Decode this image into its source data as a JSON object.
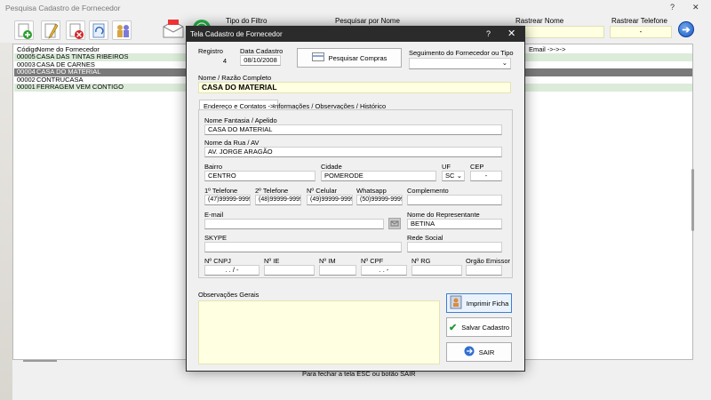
{
  "main_window": {
    "title": "Pesquisa Cadastro de Fornecedor",
    "help_glyph": "?",
    "close_glyph": "✕",
    "filter_type_label": "Tipo do Filtro",
    "search_name_label": "Pesquisar por Nome",
    "track_name_label": "Rastrear Nome",
    "track_phone_label": "Rastrear Telefone",
    "track_phone_value": "-",
    "email_header": "Email ->->->",
    "go_glyph": "➔",
    "footer_hint": "Para fechar a tela ESC ou botão SAIR"
  },
  "list": {
    "headers": {
      "code": "Código",
      "name": "Nome do Fornecedor"
    },
    "rows": [
      {
        "code": "00005",
        "name": "CASA DAS TINTAS RIBEIROS",
        "state": "green"
      },
      {
        "code": "00003",
        "name": "CASA DE CARNES",
        "state": "white"
      },
      {
        "code": "00004",
        "name": "CASA DO MATERIAL",
        "state": "selected"
      },
      {
        "code": "00002",
        "name": "CONTRUCASA",
        "state": "white"
      },
      {
        "code": "00001",
        "name": "FERRAGEM VEM CONTIGO",
        "state": "green"
      }
    ]
  },
  "dialog": {
    "title": "Tela Cadastro de Fornecedor",
    "help_glyph": "?",
    "close_glyph": "✕",
    "registro_label": "Registro",
    "registro_value": "4",
    "data_label": "Data Cadastro",
    "data_value": "08/10/2008",
    "pesquisar_compras": "Pesquisar Compras",
    "segmento_label": "Seguimento do Fornecedor ou Tipo",
    "segmento_value": "",
    "razao_label": "Nome / Razão Completo",
    "razao_value": "CASA DO MATERIAL",
    "tabs": [
      {
        "label": "Endereço e Contatos ->"
      },
      {
        "label": "Informações / Observações / Histórico"
      }
    ],
    "fantasia_label": "Nome Fantasia / Apelido",
    "fantasia_value": "CASA DO MATERIAL",
    "rua_label": "Nome da Rua / AV",
    "rua_value": "AV. JORGE ARAGÃO",
    "bairro_label": "Bairro",
    "bairro_value": "CENTRO",
    "cidade_label": "Cidade",
    "cidade_value": "POMERODE",
    "uf_label": "UF",
    "uf_value": "SC",
    "cep_label": "CEP",
    "cep_value": "-",
    "tel1_label": "1º Telefone",
    "tel1_value": "(47)99999-9999",
    "tel2_label": "2º Telefone",
    "tel2_value": "(48)99999-9999",
    "celular_label": "Nº Celular",
    "celular_value": "(49)99999-9999",
    "whatsapp_label": "Whatsapp",
    "whatsapp_value": "(50)99999-9999",
    "complemento_label": "Complemento",
    "complemento_value": "",
    "email_label": "E-mail",
    "email_value": "",
    "representante_label": "Nome do Representante",
    "representante_value": "BETINA",
    "skype_label": "SKYPE",
    "skype_value": "",
    "rede_label": "Rede Social",
    "rede_value": "",
    "cnpj_label": "Nº CNPJ",
    "cnpj_value": ". . / -",
    "ie_label": "Nº IE",
    "im_label": "Nº IM",
    "cpf_label": "Nº CPF",
    "cpf_value": ". . -",
    "rg_label": "Nº RG",
    "orgao_label": "Orgão Emissor",
    "obs_label": "Observações Gerais",
    "imprimir": "Imprimir Ficha",
    "salvar": "Salvar Cadastro",
    "sair": "SAIR"
  },
  "colors": {
    "row_green": "#dbecd9",
    "row_selected": "#7a7a7a",
    "field_yellow": "#ffffe1",
    "dialog_titlebar": "#2b2b2b"
  }
}
